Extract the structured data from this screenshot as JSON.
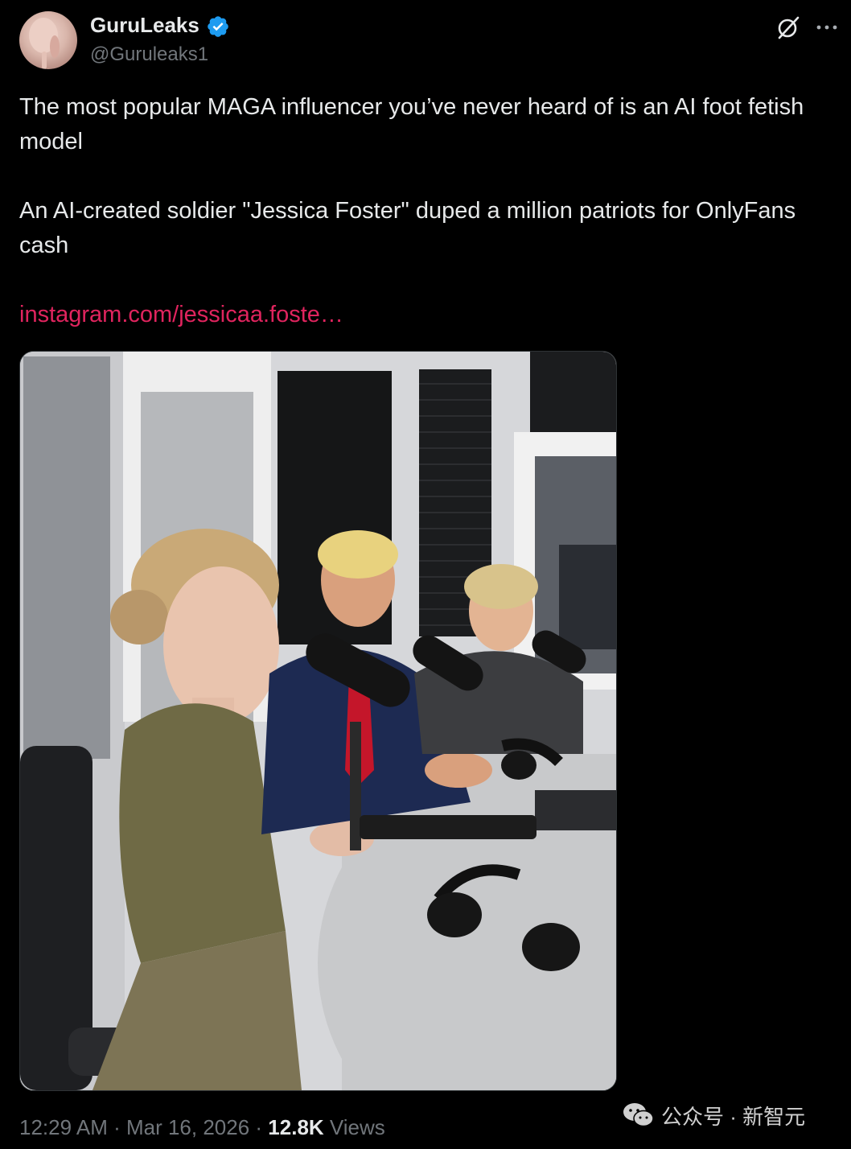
{
  "author": {
    "display_name": "GuruLeaks",
    "handle": "@Guruleaks1",
    "verified_icon": "verified-badge-icon",
    "avatar_icon": "avatar"
  },
  "header_actions": {
    "grok_icon": "grok-icon",
    "more_icon": "more-icon"
  },
  "tweet": {
    "line1": "The most popular MAGA influencer you’ve never heard of is an AI foot fetish model",
    "line2": "An AI-created soldier \"Jessica Foster\" duped a million patriots for OnlyFans cash",
    "link": "instagram.com/jessicaa.foste…"
  },
  "meta": {
    "time": "12:29 AM",
    "sep1": " · ",
    "date": "Mar 16, 2026",
    "sep2": " · ",
    "views_count": "12.8K",
    "views_label": " Views"
  },
  "watermark": {
    "text": "公众号 · 新智元",
    "icon": "wechat-icon"
  },
  "colors": {
    "background": "#000000",
    "text": "#e7e9ea",
    "muted": "#71767b",
    "link": "#e0245e",
    "verified": "#1d9bf0"
  }
}
